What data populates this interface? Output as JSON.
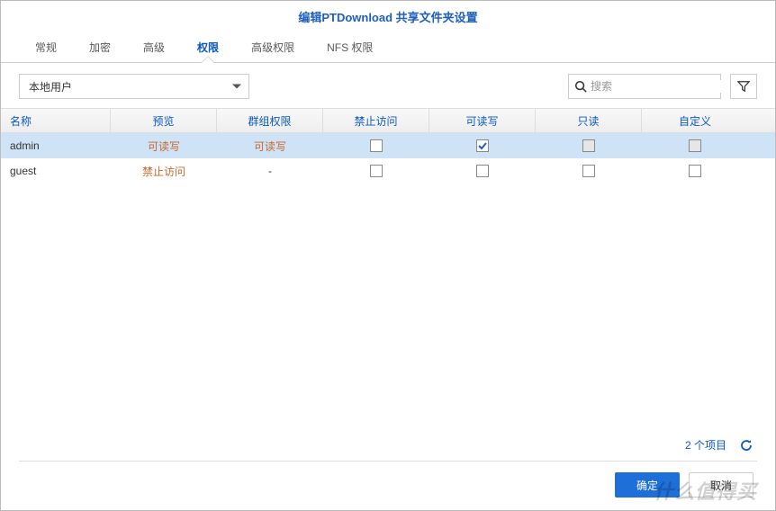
{
  "title": "编辑PTDownload 共享文件夹设置",
  "tabs": [
    {
      "label": "常规",
      "active": false
    },
    {
      "label": "加密",
      "active": false
    },
    {
      "label": "高级",
      "active": false
    },
    {
      "label": "权限",
      "active": true
    },
    {
      "label": "高级权限",
      "active": false
    },
    {
      "label": "NFS 权限",
      "active": false
    }
  ],
  "user_type_dropdown": {
    "selected": "本地用户"
  },
  "search": {
    "placeholder": "搜索"
  },
  "columns": {
    "name": "名称",
    "preview": "预览",
    "group": "群组权限",
    "deny": "禁止访问",
    "rw": "可读写",
    "ro": "只读",
    "custom": "自定义"
  },
  "rows": [
    {
      "name": "admin",
      "preview": "可读写",
      "group": "可读写",
      "deny": false,
      "rw": true,
      "ro_disabled": true,
      "custom_disabled": true,
      "selected": true
    },
    {
      "name": "guest",
      "preview": "禁止访问",
      "group": "-",
      "deny": false,
      "rw": false,
      "ro_disabled": false,
      "custom_disabled": false,
      "selected": false
    }
  ],
  "footer": {
    "count_text": "2 个项目"
  },
  "buttons": {
    "ok": "确定",
    "cancel": "取消"
  },
  "watermark": "什么值得买"
}
